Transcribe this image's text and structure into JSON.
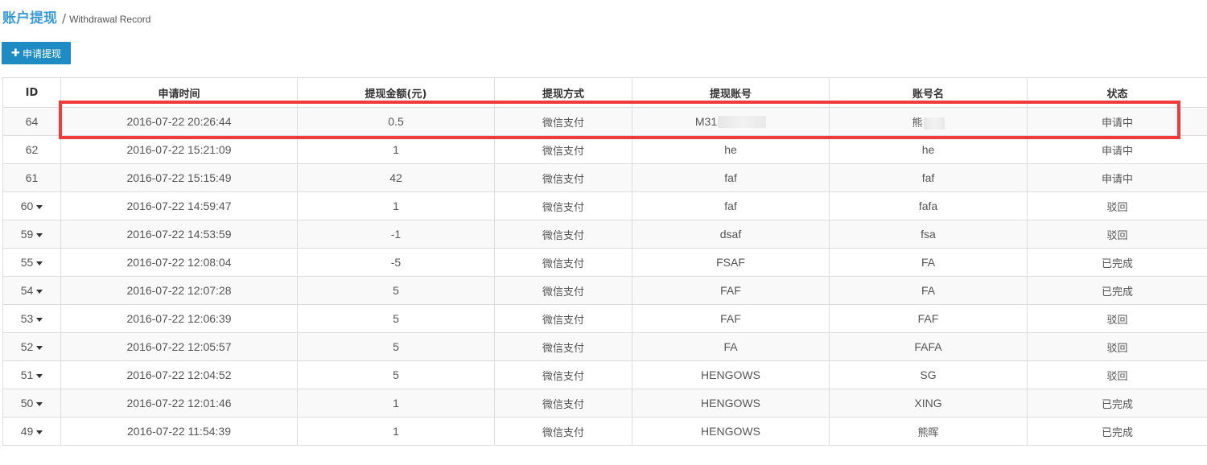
{
  "header": {
    "title": "账户提现",
    "separator": "/",
    "subtitle": "Withdrawal Record"
  },
  "toolbar": {
    "apply_icon": "plus-icon",
    "apply_label": "申请提现"
  },
  "table": {
    "columns": [
      "ID",
      "申请时间",
      "提现金额(元)",
      "提现方式",
      "提现账号",
      "账号名",
      "状态"
    ],
    "rows": [
      {
        "id": "64",
        "expandable": false,
        "time": "2016-07-22 20:26:44",
        "amount": "0.5",
        "method": "微信支付",
        "account": "M31",
        "account_redacted": true,
        "name": "熊",
        "name_redacted": true,
        "status": "申请中"
      },
      {
        "id": "62",
        "expandable": false,
        "time": "2016-07-22 15:21:09",
        "amount": "1",
        "method": "微信支付",
        "account": "he",
        "account_redacted": false,
        "name": "he",
        "name_redacted": false,
        "status": "申请中"
      },
      {
        "id": "61",
        "expandable": false,
        "time": "2016-07-22 15:15:49",
        "amount": "42",
        "method": "微信支付",
        "account": "faf",
        "account_redacted": false,
        "name": "faf",
        "name_redacted": false,
        "status": "申请中"
      },
      {
        "id": "60",
        "expandable": true,
        "time": "2016-07-22 14:59:47",
        "amount": "1",
        "method": "微信支付",
        "account": "faf",
        "account_redacted": false,
        "name": "fafa",
        "name_redacted": false,
        "status": "驳回"
      },
      {
        "id": "59",
        "expandable": true,
        "time": "2016-07-22 14:53:59",
        "amount": "-1",
        "method": "微信支付",
        "account": "dsaf",
        "account_redacted": false,
        "name": "fsa",
        "name_redacted": false,
        "status": "驳回"
      },
      {
        "id": "55",
        "expandable": true,
        "time": "2016-07-22 12:08:04",
        "amount": "-5",
        "method": "微信支付",
        "account": "FSAF",
        "account_redacted": false,
        "name": "FA",
        "name_redacted": false,
        "status": "已完成"
      },
      {
        "id": "54",
        "expandable": true,
        "time": "2016-07-22 12:07:28",
        "amount": "5",
        "method": "微信支付",
        "account": "FAF",
        "account_redacted": false,
        "name": "FA",
        "name_redacted": false,
        "status": "已完成"
      },
      {
        "id": "53",
        "expandable": true,
        "time": "2016-07-22 12:06:39",
        "amount": "5",
        "method": "微信支付",
        "account": "FAF",
        "account_redacted": false,
        "name": "FAF",
        "name_redacted": false,
        "status": "驳回"
      },
      {
        "id": "52",
        "expandable": true,
        "time": "2016-07-22 12:05:57",
        "amount": "5",
        "method": "微信支付",
        "account": "FA",
        "account_redacted": false,
        "name": "FAFA",
        "name_redacted": false,
        "status": "驳回"
      },
      {
        "id": "51",
        "expandable": true,
        "time": "2016-07-22 12:04:52",
        "amount": "5",
        "method": "微信支付",
        "account": "HENGOWS",
        "account_redacted": false,
        "name": "SG",
        "name_redacted": false,
        "status": "驳回"
      },
      {
        "id": "50",
        "expandable": true,
        "time": "2016-07-22 12:01:46",
        "amount": "1",
        "method": "微信支付",
        "account": "HENGOWS",
        "account_redacted": false,
        "name": "XING",
        "name_redacted": false,
        "status": "已完成"
      },
      {
        "id": "49",
        "expandable": true,
        "time": "2016-07-22 11:54:39",
        "amount": "1",
        "method": "微信支付",
        "account": "HENGOWS",
        "account_redacted": false,
        "name": "熊晖",
        "name_redacted": false,
        "status": "已完成"
      }
    ]
  },
  "highlight": {
    "row_id": "64",
    "color": "#ef3b3b"
  },
  "colors": {
    "accent": "#3a9ad9",
    "button": "#1e8bc3"
  }
}
